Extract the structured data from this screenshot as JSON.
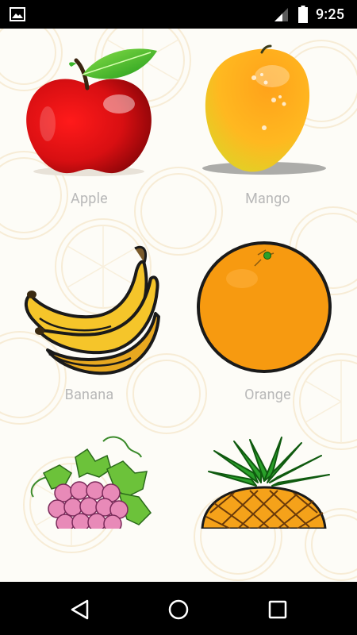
{
  "status_bar": {
    "time": "9:25",
    "icons": [
      "gallery-icon",
      "signal-icon",
      "battery-icon"
    ]
  },
  "fruits": [
    {
      "name": "Apple",
      "icon": "apple-icon"
    },
    {
      "name": "Mango",
      "icon": "mango-icon"
    },
    {
      "name": "Banana",
      "icon": "banana-icon"
    },
    {
      "name": "Orange",
      "icon": "orange-icon"
    },
    {
      "name": "",
      "icon": "grapes-icon"
    },
    {
      "name": "",
      "icon": "pineapple-icon"
    }
  ],
  "nav_bar": {
    "buttons": [
      "back-icon",
      "home-icon",
      "recents-icon"
    ]
  },
  "colors": {
    "status_bar_bg": "#000000",
    "nav_bar_bg": "#000000",
    "label_text": "#b8b8b8",
    "content_bg": "#fdfcf7"
  }
}
